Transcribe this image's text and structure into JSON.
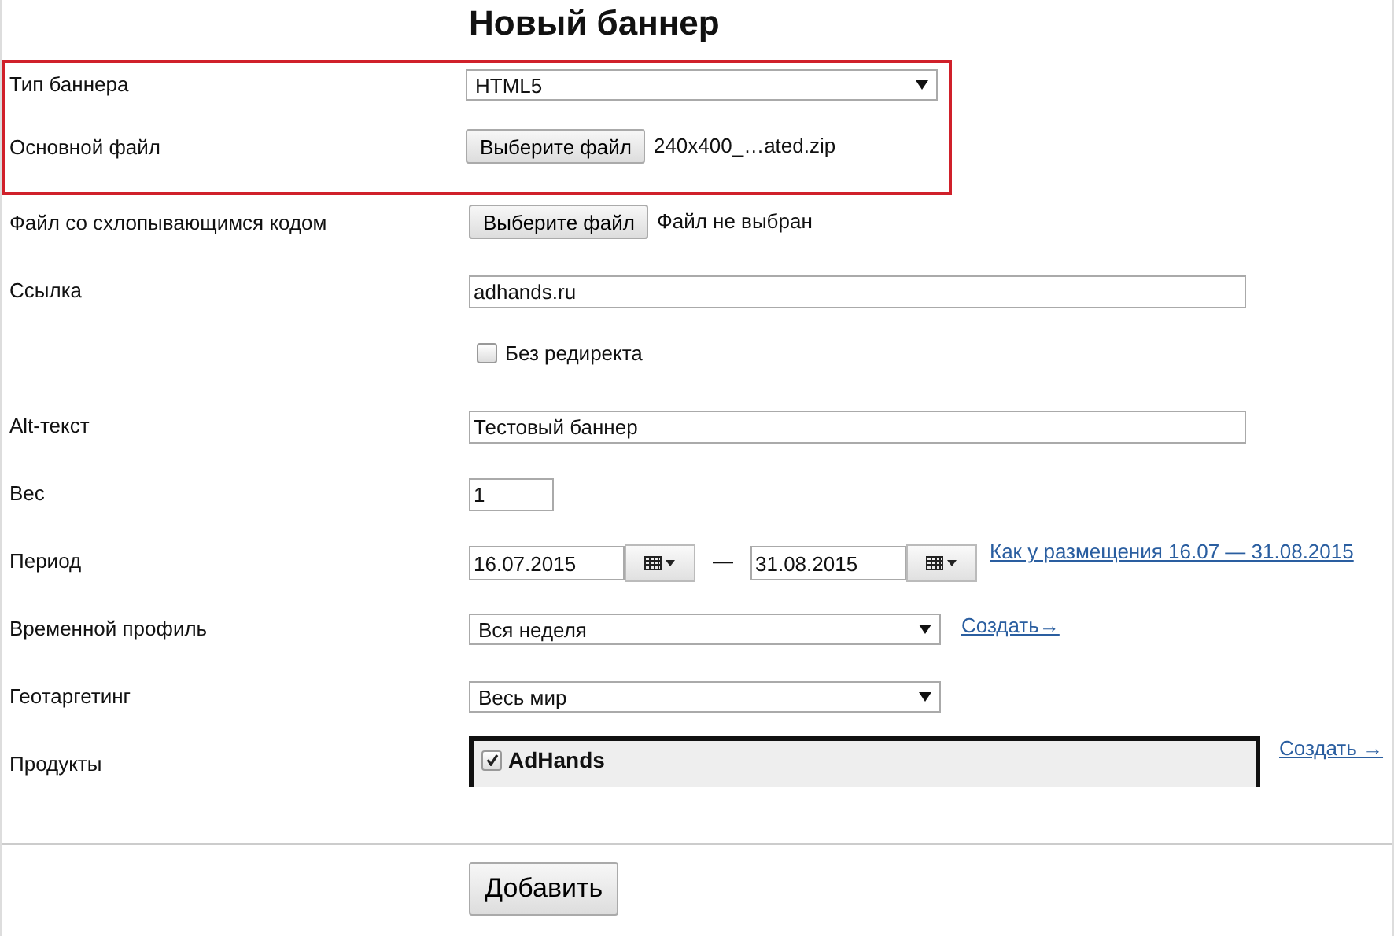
{
  "title": "Новый баннер",
  "highlighted_fields": [
    {
      "kind": "select",
      "label": "Тип баннера",
      "value": "HTML5"
    },
    {
      "kind": "file",
      "label": "Основной файл",
      "button": "Выберите файл",
      "file": "240x400_…ated.zip"
    }
  ],
  "fields": [
    {
      "kind": "file",
      "label": "Файл со схлопывающимся кодом",
      "button": "Выберите файл",
      "file": "Файл не выбран"
    },
    {
      "kind": "text",
      "label": "Ссылка",
      "value": "adhands.ru"
    },
    {
      "kind": "checkbox",
      "text": "Без редиректа",
      "checked": false
    },
    {
      "kind": "text",
      "label": "Alt-текст",
      "value": "Тестовый баннер"
    },
    {
      "kind": "short",
      "label": "Вес",
      "value": "1"
    },
    {
      "kind": "period",
      "label": "Период",
      "from": "16.07.2015",
      "dash": "—",
      "to": "31.08.2015",
      "link": "Как у размещения 16.07 — 31.08.2015"
    },
    {
      "kind": "select",
      "label": "Временной профиль",
      "value": "Вся неделя",
      "link": "Создать→"
    },
    {
      "kind": "select",
      "label": "Геотаргетинг",
      "value": "Весь мир"
    },
    {
      "kind": "products",
      "label": "Продукты",
      "items": [
        {
          "name": "AdHands",
          "checked": true
        }
      ],
      "link": "Создать →"
    }
  ],
  "submit": "Добавить"
}
